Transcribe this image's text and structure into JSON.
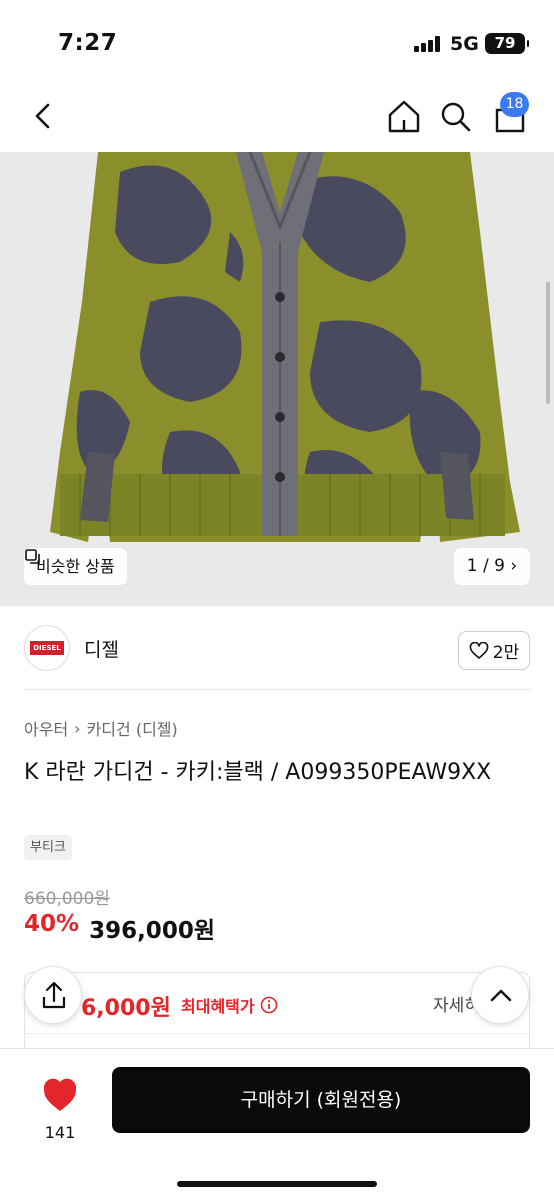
{
  "status": {
    "time": "7:27",
    "network": "5G",
    "battery": "79"
  },
  "nav": {
    "cart_count": "18"
  },
  "gallery": {
    "similar_label": "비슷한 상품",
    "counter": "1 / 9"
  },
  "brand": {
    "logo_text": "DIESEL",
    "name": "디젤",
    "likes": "2만"
  },
  "product": {
    "breadcrumb": [
      "아우터",
      "카디건 (디젤)"
    ],
    "title": "K 라란 가디건 - 카키:블랙 / A099350PEAW9XX",
    "tag": "부티크",
    "original_price": "660,000원",
    "discount": "40%",
    "price": "396,000원"
  },
  "benefit": {
    "price": "6,000원",
    "label": "최대혜택가",
    "detail": "자세히"
  },
  "bottom": {
    "like_count": "141",
    "buy_label": "구매하기 (회원전용)"
  },
  "colors": {
    "accent_red": "#e3262c",
    "badge_blue": "#3a7bf0",
    "cardigan_khaki": "#8a8f2c",
    "cardigan_navy": "#4a4a5e"
  }
}
